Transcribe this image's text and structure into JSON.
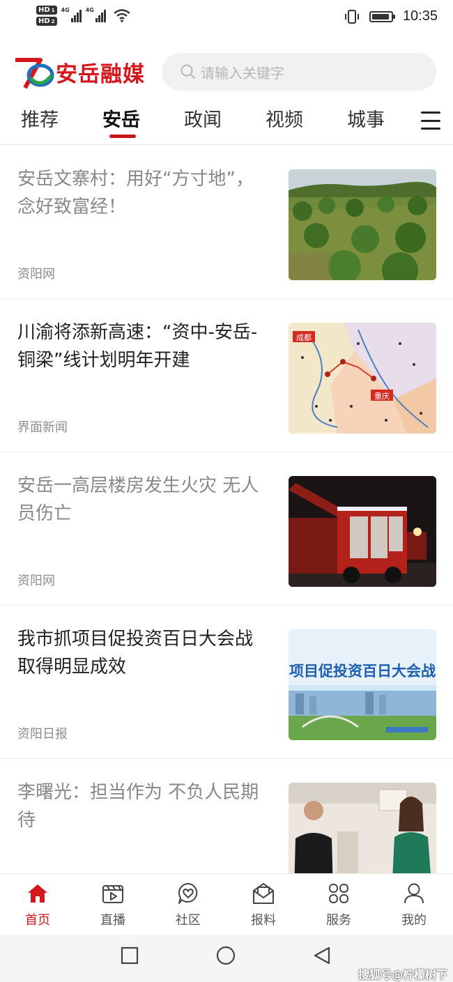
{
  "status_bar": {
    "hd1": "HD",
    "hd1_sub": "1",
    "hd2": "HD",
    "hd2_sub": "2",
    "net1": "4G",
    "net2": "4G",
    "battery_level": 0.95,
    "time": "10:35"
  },
  "header": {
    "app_name": "安岳融媒",
    "search_placeholder": "请输入关键字"
  },
  "tabs": [
    {
      "label": "推荐",
      "active": false
    },
    {
      "label": "安岳",
      "active": true
    },
    {
      "label": "政闻",
      "active": false
    },
    {
      "label": "视频",
      "active": false
    },
    {
      "label": "城事",
      "active": false
    }
  ],
  "thumb_texts": {
    "chengdu": "成都",
    "chongqing": "重庆",
    "banner": "项目促投资百日大会战"
  },
  "news": [
    {
      "title": "安岳文寨村：用好“方寸地”，念好致富经！",
      "source": "资阳网",
      "read": true,
      "image": "orchard"
    },
    {
      "title": "川渝将添新高速：“资中-安岳-铜梁”线计划明年开建",
      "source": "界面新闻",
      "read": false,
      "image": "map"
    },
    {
      "title": "安岳一高层楼房发生火灾 无人员伤亡",
      "source": "资阳网",
      "read": true,
      "image": "fire-truck"
    },
    {
      "title": "我市抓项目促投资百日大会战取得明显成效",
      "source": "资阳日报",
      "read": false,
      "image": "banner"
    },
    {
      "title": "李曙光：担当作为 不负人民期待",
      "source": "",
      "read": true,
      "image": "people"
    }
  ],
  "bottom_nav": [
    {
      "label": "首页",
      "icon": "home-icon",
      "active": true
    },
    {
      "label": "直播",
      "icon": "live-icon",
      "active": false
    },
    {
      "label": "社区",
      "icon": "community-icon",
      "active": false
    },
    {
      "label": "报料",
      "icon": "report-icon",
      "active": false
    },
    {
      "label": "服务",
      "icon": "service-icon",
      "active": false
    },
    {
      "label": "我的",
      "icon": "profile-icon",
      "active": false
    }
  ],
  "watermark": "搜狐号@柠檬树下",
  "colors": {
    "brand_red": "#d4171d",
    "tab_underline": "#c8161d",
    "read_title": "#888888",
    "unread_title": "#222222"
  }
}
